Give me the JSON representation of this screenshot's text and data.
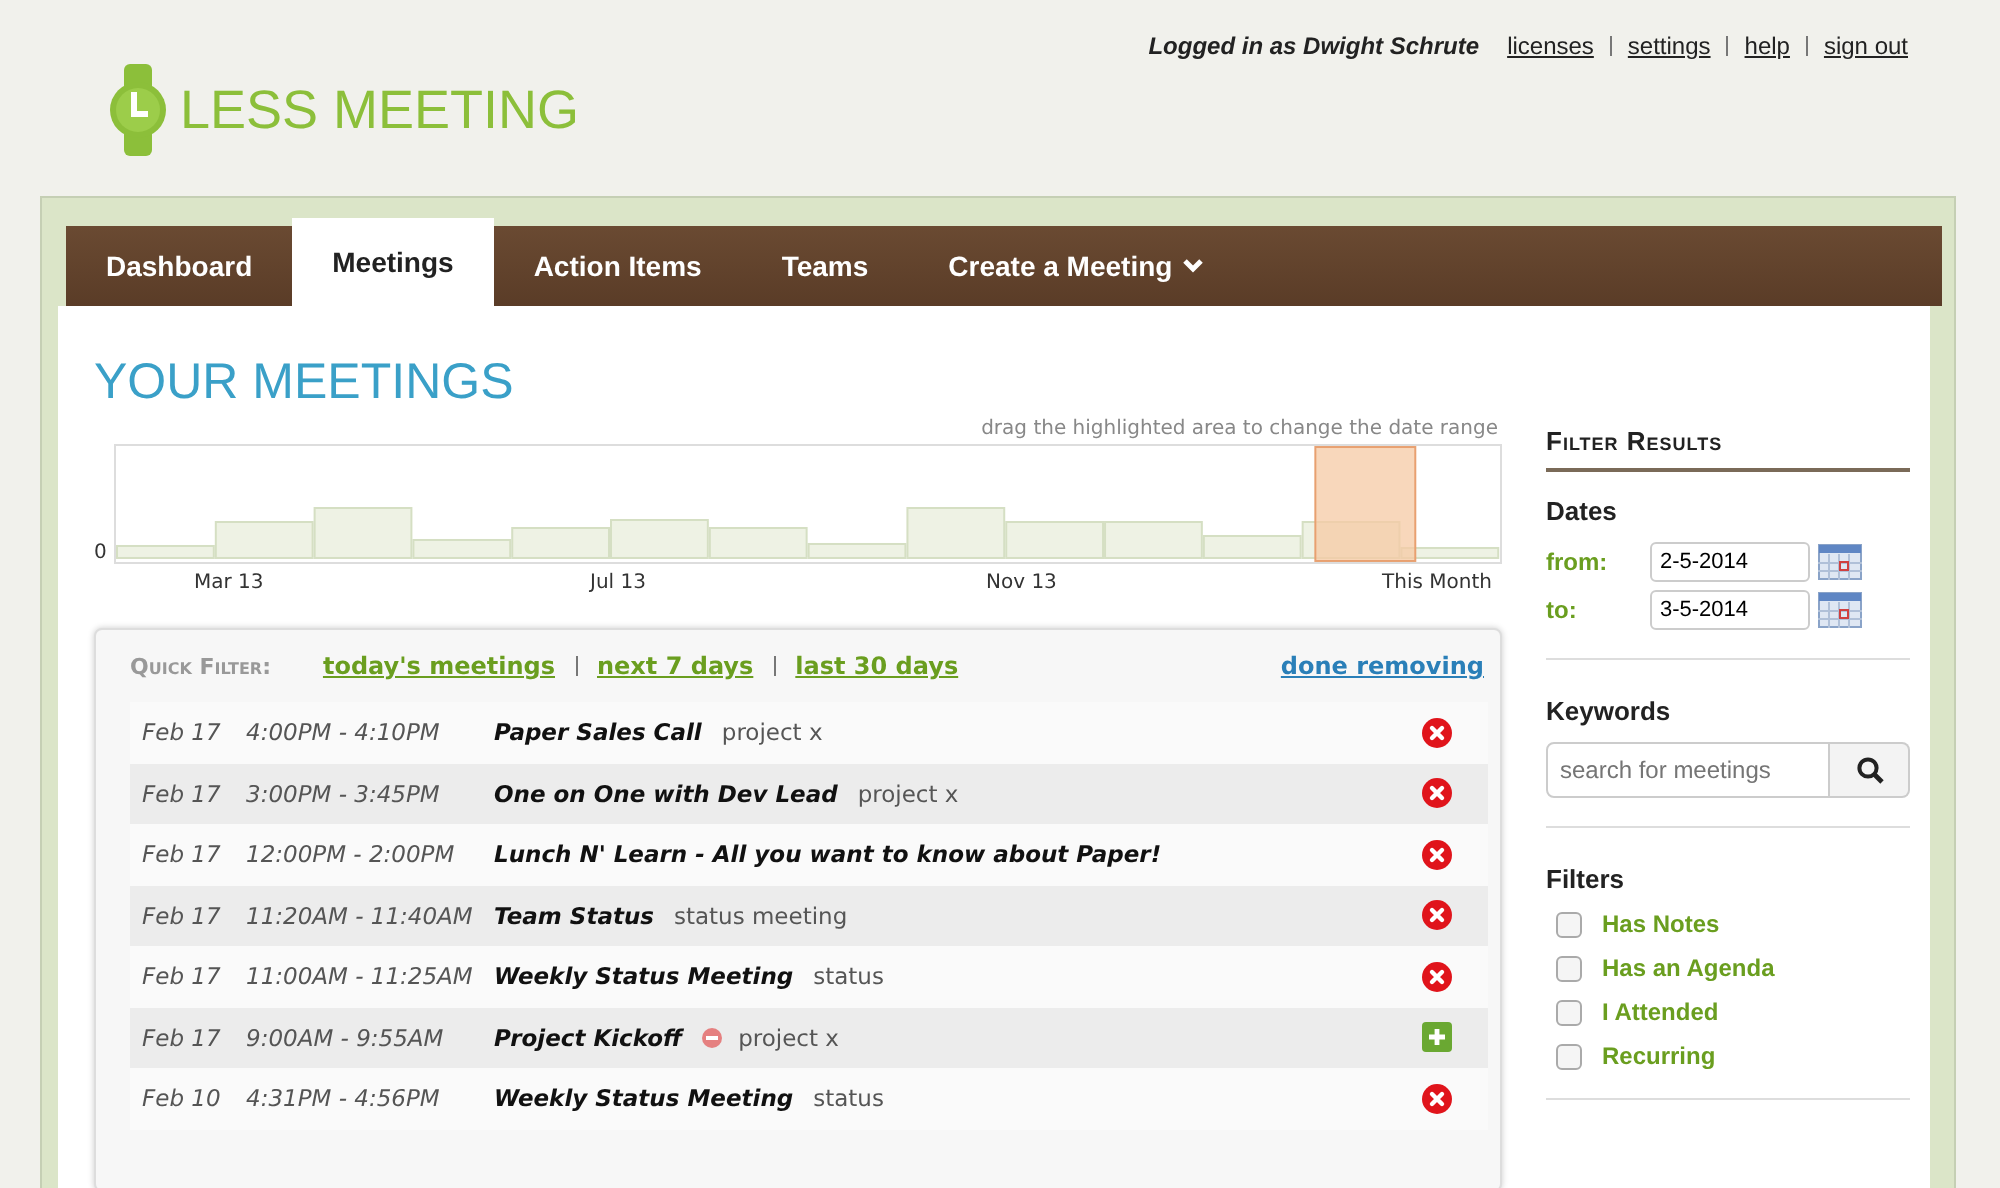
{
  "header": {
    "logo": "LESS MEETING",
    "user": "Logged in as Dwight Schrute",
    "links": [
      "licenses",
      "settings",
      "help",
      "sign out"
    ]
  },
  "tabs": [
    {
      "label": "Dashboard",
      "selected": false,
      "dropdown": false
    },
    {
      "label": "Meetings",
      "selected": true,
      "dropdown": false
    },
    {
      "label": "Action Items",
      "selected": false,
      "dropdown": false
    },
    {
      "label": "Teams",
      "selected": false,
      "dropdown": false
    },
    {
      "label": "Create a Meeting",
      "selected": false,
      "dropdown": true
    }
  ],
  "page_title": "YOUR MEETINGS",
  "timeline": {
    "hint": "drag the highlighted area to change the date range",
    "zero_label": "0",
    "axis_labels": [
      "Mar 13",
      "Jul 13",
      "Nov 13",
      "This Month"
    ]
  },
  "quick_filter": {
    "label": "Quick Filter:",
    "links": [
      "today's meetings",
      "next 7 days",
      "last 30 days"
    ],
    "done": "done removing"
  },
  "meetings": [
    {
      "date": "Feb 17",
      "time": "4:00PM - 4:10PM",
      "title": "Paper Sales Call",
      "tag": "project x",
      "excluded": false,
      "kind": "removable"
    },
    {
      "date": "Feb 17",
      "time": "3:00PM - 3:45PM",
      "title": "One on One with Dev Lead",
      "tag": "project x",
      "excluded": false,
      "kind": "removable"
    },
    {
      "date": "Feb 17",
      "time": "12:00PM - 2:00PM",
      "title": "Lunch N' Learn - All you want to know about Paper!",
      "excluded": false,
      "kind": "removable"
    },
    {
      "date": "Feb 17",
      "time": "11:20AM - 11:40AM",
      "title": "Team Status",
      "tag": "status meeting",
      "excluded": false,
      "kind": "removable"
    },
    {
      "date": "Feb 17",
      "time": "11:00AM - 11:25AM",
      "title": "Weekly Status Meeting",
      "tag": "status",
      "excluded": false,
      "kind": "removable"
    },
    {
      "date": "Feb 17",
      "time": "9:00AM - 9:55AM",
      "title": "Project Kickoff",
      "tag": "project x",
      "excluded": true,
      "kind": "addable"
    },
    {
      "date": "Feb 10",
      "time": "4:31PM - 4:56PM",
      "title": "Weekly Status Meeting",
      "tag": "status",
      "excluded": false,
      "kind": "removable"
    }
  ],
  "sidebar": {
    "title": "Filter Results",
    "dates_heading": "Dates",
    "from_label": "from:",
    "from_value": "2-5-2014",
    "to_label": "to:",
    "to_value": "3-5-2014",
    "keywords_heading": "Keywords",
    "search_placeholder": "search for meetings",
    "filters_heading": "Filters",
    "filters": [
      {
        "label": "Has Notes",
        "checked": false
      },
      {
        "label": "Has an Agenda",
        "checked": false
      },
      {
        "label": "I Attended",
        "checked": false
      },
      {
        "label": "Recurring",
        "checked": false
      }
    ]
  }
}
